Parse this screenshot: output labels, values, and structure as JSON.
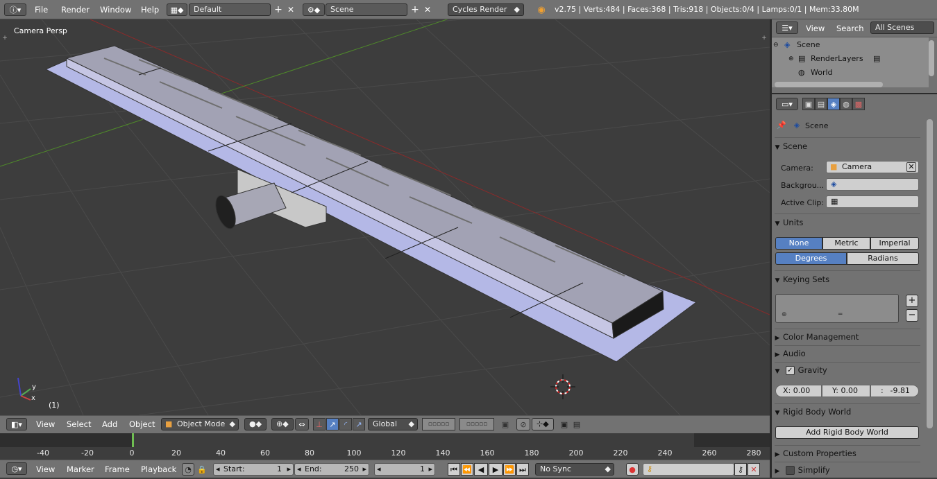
{
  "header": {
    "menus": [
      "File",
      "Render",
      "Window",
      "Help"
    ],
    "screen_layout": "Default",
    "scene": "Scene",
    "render_engine": "Cycles Render",
    "stats": "v2.75 | Verts:484 | Faces:368 | Tris:918 | Objects:0/4 | Lamps:0/1 | Mem:33.80M"
  },
  "viewport": {
    "label": "Camera Persp",
    "frame_label": "(1)",
    "axis_y": "y",
    "axis_x": "x",
    "header": {
      "menus": [
        "View",
        "Select",
        "Add",
        "Object"
      ],
      "mode": "Object Mode",
      "orientation": "Global"
    }
  },
  "timeline": {
    "ticks": [
      "-40",
      "-20",
      "0",
      "20",
      "40",
      "60",
      "80",
      "100",
      "120",
      "140",
      "160",
      "180",
      "200",
      "220",
      "240",
      "260",
      "280"
    ],
    "current_frame": 1,
    "menus": [
      "View",
      "Marker",
      "Frame",
      "Playback"
    ],
    "start_label": "Start:",
    "start_value": "1",
    "end_label": "End:",
    "end_value": "250",
    "frame_value": "1",
    "sync": "No Sync"
  },
  "outliner": {
    "menus": [
      "View",
      "Search"
    ],
    "filter": "All Scenes",
    "items": [
      "Scene",
      "RenderLayers",
      "World"
    ]
  },
  "properties": {
    "breadcrumb": "Scene",
    "scene_panel": {
      "title": "Scene",
      "camera_label": "Camera:",
      "camera_value": "Camera",
      "background_label": "Backgrou...",
      "clip_label": "Active Clip:"
    },
    "units_panel": {
      "title": "Units",
      "systems": [
        "None",
        "Metric",
        "Imperial"
      ],
      "rotation": [
        "Degrees",
        "Radians"
      ]
    },
    "keying_sets": {
      "title": "Keying Sets"
    },
    "color_management": "Color Management",
    "audio": "Audio",
    "gravity": {
      "title": "Gravity",
      "x": "X: 0.00",
      "y": "Y:  0.00",
      "z_label": ":",
      "z_value": "-9.81"
    },
    "rigid_body": {
      "title": "Rigid Body World",
      "button": "Add Rigid Body World"
    },
    "custom_properties": "Custom Properties",
    "simplify": "Simplify"
  },
  "colors": {
    "accent": "#5680c2",
    "viewport_bg": "#3d3d3d",
    "panel_bg": "#727272"
  }
}
